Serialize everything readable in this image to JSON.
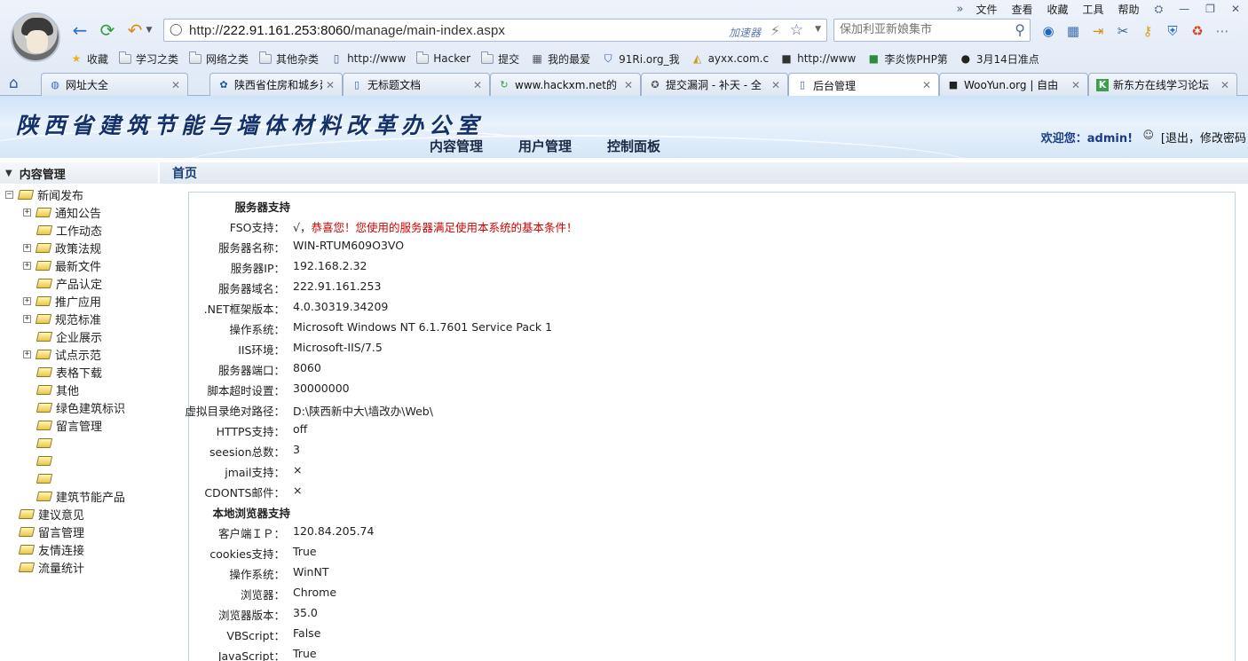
{
  "browser": {
    "url_prefix": "http://",
    "url_host": "222.91.161.253:8060",
    "url_path": "/manage/main-index.aspx",
    "accelerator_label": "加速器",
    "search_placeholder": "保加利亚新娘集市",
    "menu": [
      "文件",
      "查看",
      "收藏",
      "工具",
      "帮助"
    ],
    "bookmarks": [
      {
        "label": "收藏",
        "icon": "star-icon"
      },
      {
        "label": "学习之类",
        "icon": "folder-icon"
      },
      {
        "label": "网络之类",
        "icon": "folder-icon"
      },
      {
        "label": "其他杂类",
        "icon": "folder-icon"
      },
      {
        "label": "http://www",
        "icon": "page-icon"
      },
      {
        "label": "Hacker",
        "icon": "folder-icon"
      },
      {
        "label": "提交",
        "icon": "folder-icon"
      },
      {
        "label": "我的最爱",
        "icon": "grid-icon"
      },
      {
        "label": "91Ri.org_我",
        "icon": "shield-icon"
      },
      {
        "label": "ayxx.com.c",
        "icon": "pma-icon"
      },
      {
        "label": "http://www",
        "icon": "dark-site-icon"
      },
      {
        "label": "李炎恢PHP第",
        "icon": "green-leaf-icon"
      },
      {
        "label": "3月14日准点",
        "icon": "mask-icon"
      }
    ],
    "tabs": [
      {
        "label": "网址大全",
        "icon": "globe-icon"
      },
      {
        "label": "陕西省住房和城乡建",
        "icon": "paw-icon"
      },
      {
        "label": "无标题文档",
        "icon": "page-icon"
      },
      {
        "label": "www.hackxm.net的",
        "icon": "green-arrow-icon"
      },
      {
        "label": "提交漏洞 - 补天 - 全",
        "icon": "badge-icon"
      },
      {
        "label": "后台管理",
        "icon": "page-icon"
      },
      {
        "label": "WooYun.org | 自由",
        "icon": "dark-site-icon"
      },
      {
        "label": "新东方在线学习论坛",
        "icon": "k-icon"
      }
    ]
  },
  "site": {
    "title": "陕西省建筑节能与墙体材料改革办公室",
    "nav": [
      "内容管理",
      "用户管理",
      "控制面板"
    ],
    "welcome_prefix": "欢迎您：",
    "username": "admin!",
    "logout": "[退出，修改密码"
  },
  "sidebar": {
    "title": "内容管理",
    "items": [
      {
        "label": "新闻发布",
        "level": 0,
        "toggle": "−"
      },
      {
        "label": "通知公告",
        "level": 1,
        "toggle": "+"
      },
      {
        "label": "工作动态",
        "level": 1,
        "toggle": ""
      },
      {
        "label": "政策法规",
        "level": 1,
        "toggle": "+"
      },
      {
        "label": "最新文件",
        "level": 1,
        "toggle": "+"
      },
      {
        "label": "产品认定",
        "level": 1,
        "toggle": ""
      },
      {
        "label": "推广应用",
        "level": 1,
        "toggle": "+"
      },
      {
        "label": "规范标准",
        "level": 1,
        "toggle": "+"
      },
      {
        "label": "企业展示",
        "level": 1,
        "toggle": ""
      },
      {
        "label": "试点示范",
        "level": 1,
        "toggle": "+"
      },
      {
        "label": "表格下载",
        "level": 1,
        "toggle": ""
      },
      {
        "label": "其他",
        "level": 1,
        "toggle": ""
      },
      {
        "label": "绿色建筑标识",
        "level": 1,
        "toggle": ""
      },
      {
        "label": "留言管理",
        "level": 1,
        "toggle": ""
      },
      {
        "label": "",
        "level": 1,
        "toggle": ""
      },
      {
        "label": "",
        "level": 1,
        "toggle": ""
      },
      {
        "label": "",
        "level": 1,
        "toggle": ""
      },
      {
        "label": "建筑节能产品",
        "level": 1,
        "toggle": ""
      },
      {
        "label": "建议意见",
        "level": 0,
        "toggle": ""
      },
      {
        "label": "留言管理",
        "level": 0,
        "toggle": ""
      },
      {
        "label": "友情连接",
        "level": 0,
        "toggle": ""
      },
      {
        "label": "流量统计",
        "level": 0,
        "toggle": ""
      }
    ]
  },
  "main": {
    "title": "首页",
    "rows": [
      {
        "k": "服务器支持",
        "v": "",
        "section": true
      },
      {
        "k": "FSO支持：",
        "v": "√，",
        "v_red": "恭喜您！您使用的服务器满足使用本系统的基本条件！"
      },
      {
        "k": "服务器名称：",
        "v": "WIN-RTUM609O3VO"
      },
      {
        "k": "服务器IP：",
        "v": "192.168.2.32"
      },
      {
        "k": "服务器域名：",
        "v": "222.91.161.253"
      },
      {
        "k": ".NET框架版本：",
        "v": "4.0.30319.34209"
      },
      {
        "k": "操作系统：",
        "v": "Microsoft Windows NT 6.1.7601 Service Pack 1"
      },
      {
        "k": "IIS环境：",
        "v": "Microsoft-IIS/7.5"
      },
      {
        "k": "服务器端口：",
        "v": "8060"
      },
      {
        "k": "脚本超时设置：",
        "v": "30000000"
      },
      {
        "k": "虚拟目录绝对路径：",
        "v": "D:\\陕西新中大\\墙改办\\Web\\"
      },
      {
        "k": "HTTPS支持：",
        "v": "off"
      },
      {
        "k": "seesion总数：",
        "v": "3"
      },
      {
        "k": "jmail支持：",
        "v": "×"
      },
      {
        "k": "CDONTS邮件：",
        "v": "×"
      },
      {
        "k": "本地浏览器支持",
        "v": "",
        "section": true
      },
      {
        "k": "客户端ＩＰ：",
        "v": "120.84.205.74"
      },
      {
        "k": "cookies支持：",
        "v": "True"
      },
      {
        "k": "操作系统：",
        "v": "WinNT"
      },
      {
        "k": "浏览器：",
        "v": "Chrome"
      },
      {
        "k": "浏览器版本：",
        "v": "35.0"
      },
      {
        "k": "VBScript：",
        "v": "False"
      },
      {
        "k": "JavaScript：",
        "v": "True"
      }
    ]
  }
}
